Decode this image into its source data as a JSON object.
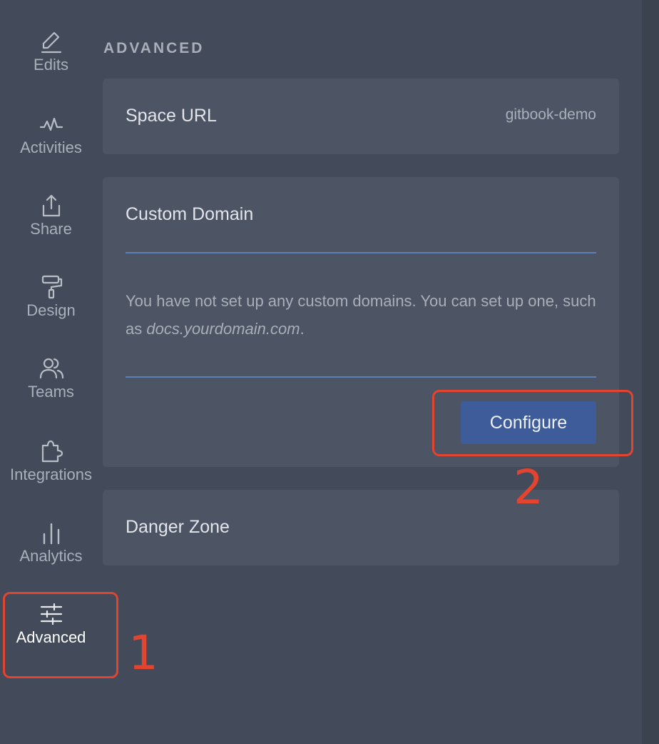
{
  "sidebar": {
    "items": [
      {
        "label": "Edits",
        "icon": "pencil-icon"
      },
      {
        "label": "Activities",
        "icon": "activity-icon"
      },
      {
        "label": "Share",
        "icon": "share-icon"
      },
      {
        "label": "Design",
        "icon": "paint-roller-icon"
      },
      {
        "label": "Teams",
        "icon": "users-icon"
      },
      {
        "label": "Integrations",
        "icon": "puzzle-icon"
      },
      {
        "label": "Analytics",
        "icon": "bar-chart-icon"
      },
      {
        "label": "Advanced",
        "icon": "sliders-icon",
        "active": true
      }
    ]
  },
  "main": {
    "section_title": "ADVANCED",
    "space_url": {
      "label": "Space URL",
      "value": "gitbook-demo"
    },
    "custom_domain": {
      "title": "Custom Domain",
      "description_prefix": "You have not set up any custom domains. You can set up one, such as ",
      "description_example": "docs.yourdomain.com",
      "description_suffix": ".",
      "button_label": "Configure"
    },
    "danger_zone": {
      "title": "Danger Zone"
    }
  },
  "annotations": {
    "step1": "1",
    "step2": "2",
    "color": "#e2442f"
  },
  "colors": {
    "background": "#434b5a",
    "card": "#4d5464",
    "accent": "#3e5c9a",
    "divider": "#5b7fb8"
  }
}
